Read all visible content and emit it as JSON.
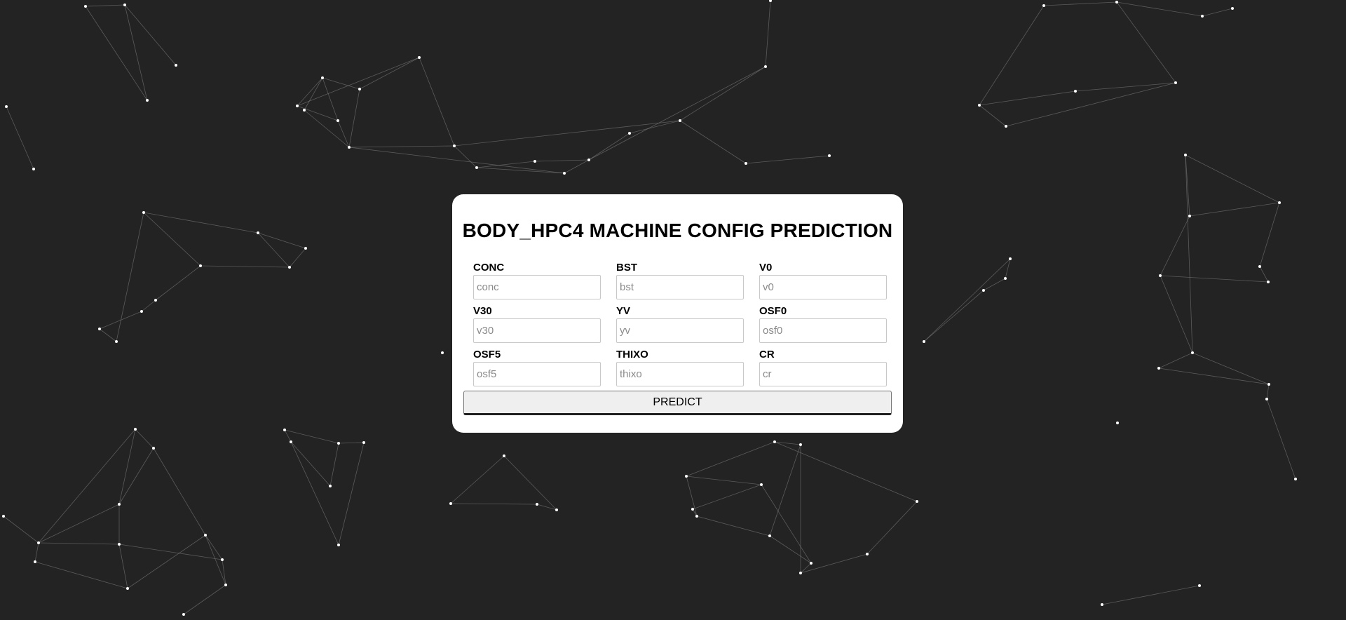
{
  "form": {
    "title": "BODY_HPC4 MACHINE CONFIG PREDICTION",
    "fields": [
      {
        "label": "CONC",
        "placeholder": "conc",
        "value": ""
      },
      {
        "label": "BST",
        "placeholder": "bst",
        "value": ""
      },
      {
        "label": "V0",
        "placeholder": "v0",
        "value": ""
      },
      {
        "label": "V30",
        "placeholder": "v30",
        "value": ""
      },
      {
        "label": "YV",
        "placeholder": "yv",
        "value": ""
      },
      {
        "label": "OSF0",
        "placeholder": "osf0",
        "value": ""
      },
      {
        "label": "OSF5",
        "placeholder": "osf5",
        "value": ""
      },
      {
        "label": "THIXO",
        "placeholder": "thixo",
        "value": ""
      },
      {
        "label": "CR",
        "placeholder": "cr",
        "value": ""
      }
    ],
    "submit_label": "PREDICT"
  },
  "background": {
    "color": "#232323",
    "node_color": "#ffffff",
    "line_color": "#888888"
  }
}
